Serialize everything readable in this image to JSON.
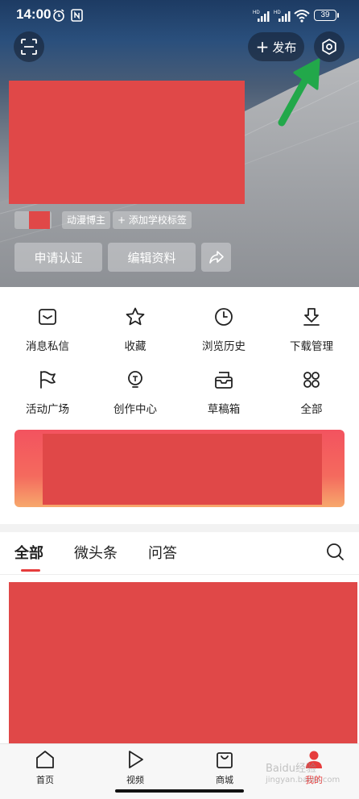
{
  "status_bar": {
    "time": "14:00",
    "battery": "39",
    "icons": [
      "alarm-icon",
      "nfc-icon",
      "hd-signal-icon",
      "hd-signal-icon",
      "wifi-icon",
      "battery-icon"
    ]
  },
  "header": {
    "scan_icon": "scan-icon",
    "publish_label": "发布",
    "publish_icon": "plus-icon",
    "settings_icon": "settings-icon",
    "tags": [
      "动漫博主",
      "+ 添加学校标签"
    ],
    "apply_cert_label": "申请认证",
    "edit_profile_label": "编辑资料",
    "share_icon": "share-icon"
  },
  "menu": [
    {
      "label": "消息私信",
      "icon": "message-icon"
    },
    {
      "label": "收藏",
      "icon": "star-icon"
    },
    {
      "label": "浏览历史",
      "icon": "clock-icon"
    },
    {
      "label": "下载管理",
      "icon": "download-icon"
    },
    {
      "label": "活动广场",
      "icon": "flag-icon"
    },
    {
      "label": "创作中心",
      "icon": "bulb-icon"
    },
    {
      "label": "草稿箱",
      "icon": "drafts-icon"
    },
    {
      "label": "全部",
      "icon": "grid-icon"
    }
  ],
  "tabs": {
    "items": [
      "全部",
      "微头条",
      "问答"
    ],
    "active_index": 0,
    "search_icon": "search-icon"
  },
  "bottom_nav": [
    {
      "label": "首页",
      "icon": "home-icon"
    },
    {
      "label": "视频",
      "icon": "play-icon"
    },
    {
      "label": "商城",
      "icon": "shop-icon"
    },
    {
      "label": "我的",
      "icon": "user-icon",
      "active": true
    }
  ],
  "watermark": {
    "text": "Baidu经验",
    "sub": "jingyan.baidu.com"
  },
  "colors": {
    "accent": "#e63c3c",
    "redaction": "#e04848",
    "arrow": "#22a84a"
  }
}
